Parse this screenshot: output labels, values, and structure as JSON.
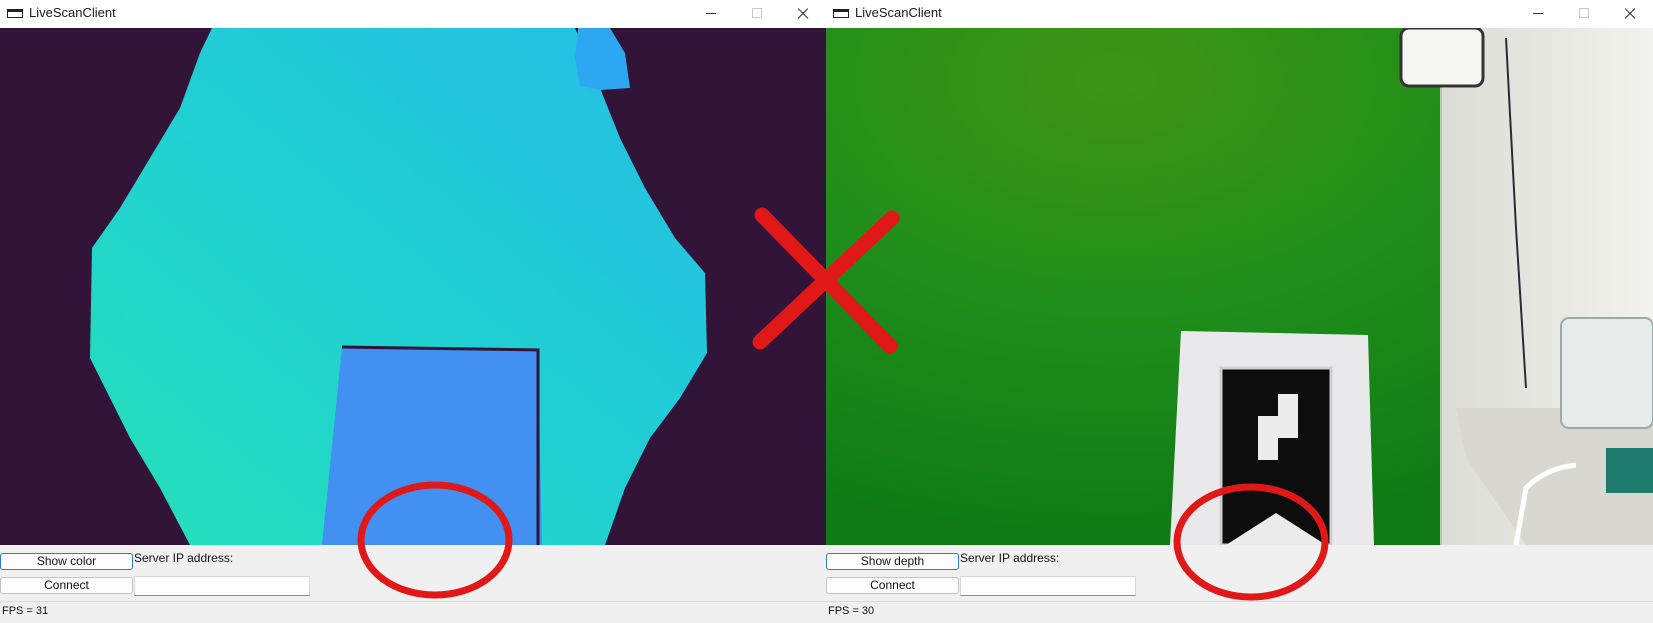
{
  "windows": [
    {
      "title": "LiveScanClient",
      "toggle_label": "Show color",
      "connect_label": "Connect",
      "server_ip_label": "Server IP address:",
      "server_ip_value": "",
      "fps_text": "FPS = 31",
      "view": "depth"
    },
    {
      "title": "LiveScanClient",
      "toggle_label": "Show depth",
      "connect_label": "Connect",
      "server_ip_label": "Server IP address:",
      "server_ip_value": "",
      "fps_text": "FPS = 30",
      "view": "color"
    }
  ],
  "annotations": {
    "cross_mark": "x-mark",
    "highlight_circles": 2,
    "color": "#e01818"
  },
  "colors": {
    "depth_background": "#311438",
    "depth_near": "#20d2c8",
    "depth_object": "#4190f2",
    "green_screen": "#1c8d1a",
    "focus_blue": "#2d7bd4"
  }
}
